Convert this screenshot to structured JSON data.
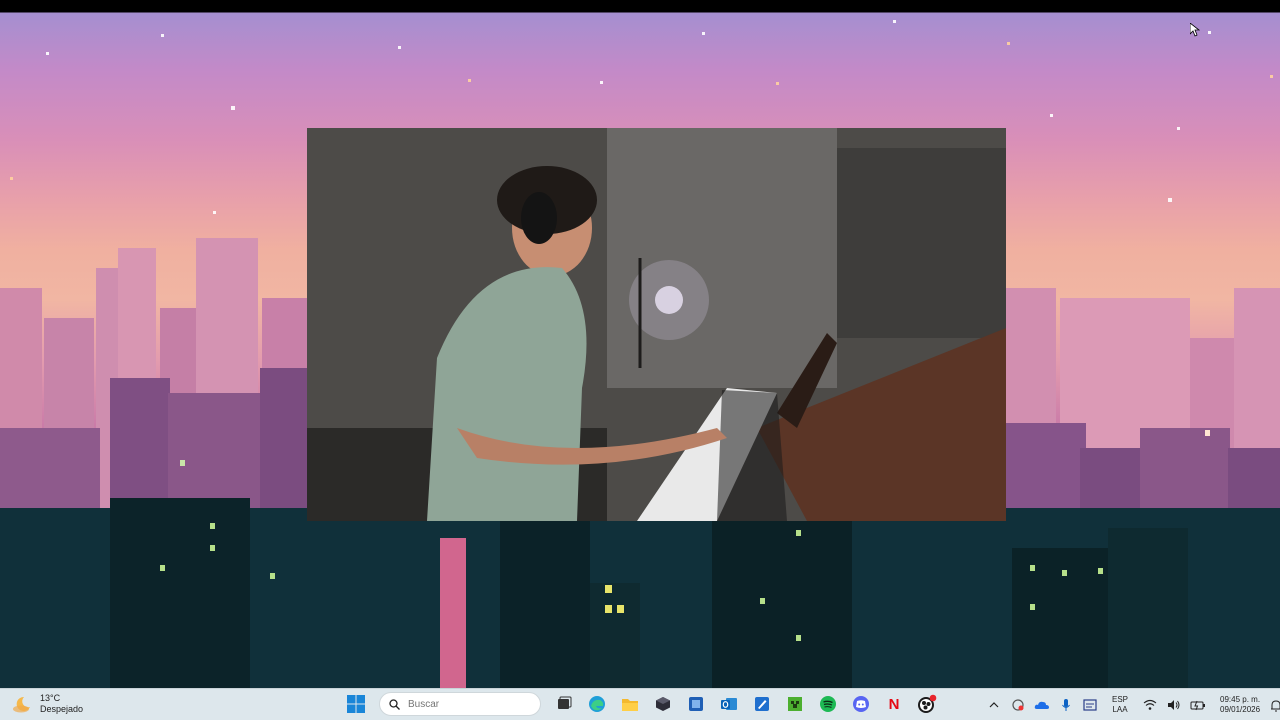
{
  "taskbar": {
    "weather": {
      "temp": "13°C",
      "condition": "Despejado",
      "icon": "moon-cloud-icon"
    },
    "search": {
      "placeholder": "Buscar",
      "icon": "search-icon"
    },
    "apps": [
      {
        "name": "start-button",
        "icon": "windows-logo-icon"
      },
      {
        "name": "task-view",
        "icon": "task-view-icon"
      },
      {
        "name": "edge",
        "icon": "edge-icon"
      },
      {
        "name": "file-explorer",
        "icon": "folder-icon"
      },
      {
        "name": "app-cube",
        "icon": "cube-icon"
      },
      {
        "name": "app-blue-square",
        "icon": "blue-app-icon"
      },
      {
        "name": "outlook",
        "icon": "outlook-icon"
      },
      {
        "name": "app-paint",
        "icon": "pen-app-icon"
      },
      {
        "name": "minecraft",
        "icon": "minecraft-icon"
      },
      {
        "name": "spotify",
        "icon": "spotify-icon"
      },
      {
        "name": "discord",
        "icon": "discord-icon"
      },
      {
        "name": "netflix",
        "icon": "netflix-icon",
        "letter": "N"
      },
      {
        "name": "obs",
        "icon": "obs-icon"
      }
    ],
    "tray": {
      "language_top": "ESP",
      "language_bottom": "LAA",
      "time": "09:45 p. m.",
      "date": "09/01/2026"
    }
  },
  "video": {
    "description_icon": "video-player"
  },
  "colors": {
    "taskbar_bg": "#dde7ec",
    "spotify": "#1db954",
    "netflix": "#e50914",
    "discord": "#5865f2",
    "windows_blue": "#0078d4",
    "minecraft": "#4caf2f"
  }
}
